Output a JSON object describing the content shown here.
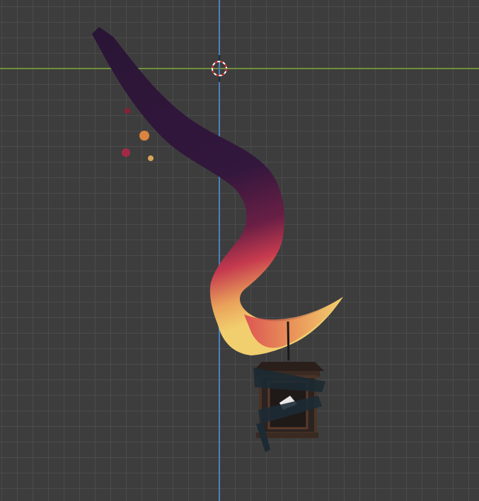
{
  "viewport": {
    "background_color": "#3d3d3d",
    "grid_color": "#4b4b4b",
    "x_axis_color": "#6f8f3a",
    "y_axis_color": "#4f7fbf",
    "cursor_icon": "3d-cursor-icon",
    "object": "tentacle-with-lantern"
  }
}
